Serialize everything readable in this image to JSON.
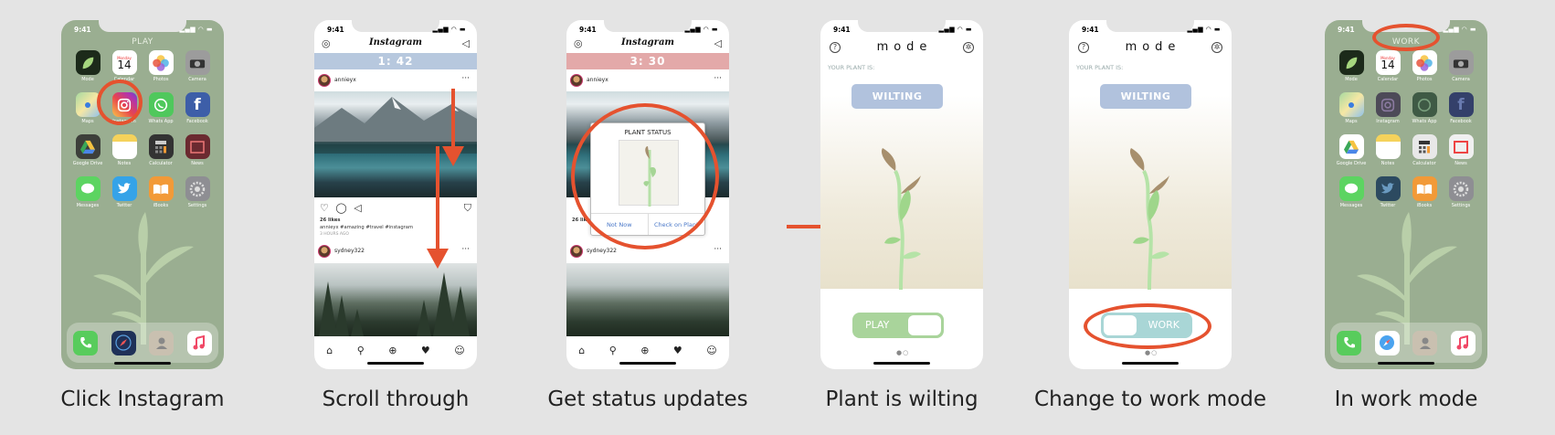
{
  "accent_color": "#e5522f",
  "steps": [
    {
      "caption": "Click Instagram"
    },
    {
      "caption": "Scroll through"
    },
    {
      "caption": "Get status updates"
    },
    {
      "caption": "Plant is wilting"
    },
    {
      "caption": "Change to work mode"
    },
    {
      "caption": "In work mode"
    }
  ],
  "status_time": "9:41",
  "home_screen": {
    "mode_label_play": "PLAY",
    "mode_label_work": "WORK",
    "calendar_day": "14",
    "calendar_weekday": "Monday",
    "apps": [
      "Mode",
      "Calendar",
      "Photos",
      "Camera",
      "Maps",
      "Instagram",
      "Whats App",
      "Facebook",
      "Google Drive",
      "Notes",
      "Calculator",
      "News",
      "Messages",
      "Twitter",
      "iBooks",
      "Settings"
    ]
  },
  "instagram": {
    "title": "Instagram",
    "timer_1": "1: 42",
    "timer_2": "3: 30",
    "timer_1_color": "#b7c8de",
    "timer_2_color": "#e3a9a9",
    "user_1": "annieyx",
    "user_2": "sydney322",
    "likes": "26 likes",
    "caption_text": "annieyx #amazing #travel #instagram",
    "time_ago": "3 HOURS AGO"
  },
  "popup": {
    "title": "PLANT STATUS",
    "button_left": "Not Now",
    "button_right": "Check on Plant"
  },
  "mode_app": {
    "title": "mode",
    "your_plant_label": "YOUR PLANT IS:",
    "state": "WILTING",
    "toggle_play": "PLAY",
    "toggle_work": "WORK",
    "play_color": "#a9d49b",
    "work_color": "#a9d6d6"
  }
}
